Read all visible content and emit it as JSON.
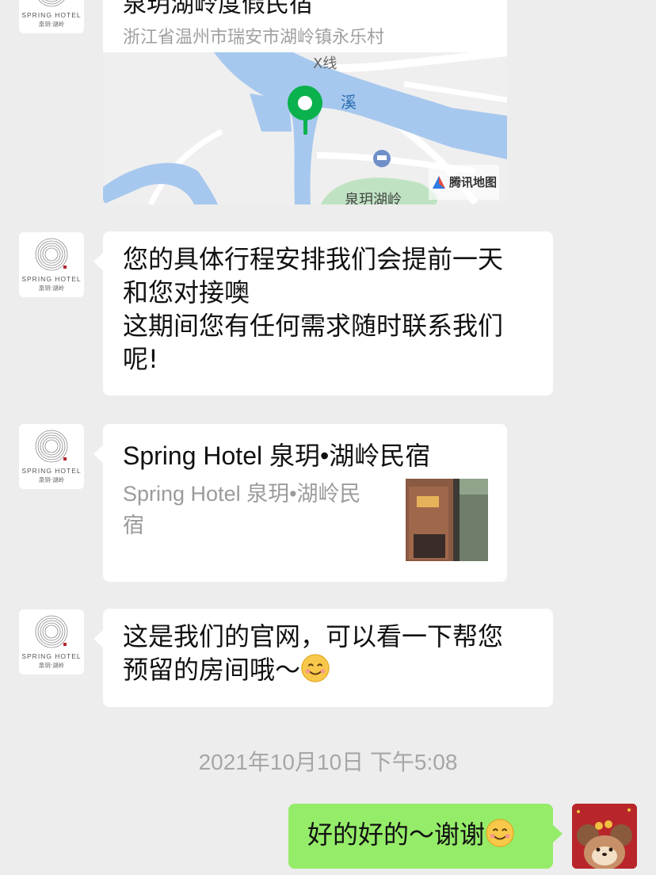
{
  "location_card": {
    "title": "泉玥湖岭度假民宿",
    "address": "浙江省温州市瑞安市湖岭镇永乐村",
    "map_provider": "腾讯地图",
    "map_labels": {
      "road": "X线",
      "river": "溪",
      "place": "泉玥湖岭"
    }
  },
  "avatar": {
    "brand": "SPRING HOTEL",
    "sub": "泉玥·湖岭",
    "seal": "玥"
  },
  "messages": {
    "m1_lines": [
      "您的具体行程安排我们会提前一天",
      "和您对接噢",
      "这期间您有任何需求随时联系我们",
      "呢!"
    ],
    "link": {
      "title": "Spring Hotel 泉玥•湖岭民宿",
      "desc_line1": "Spring Hotel 泉玥•湖岭民",
      "desc_line2": "宿"
    },
    "m3_line1": "这是我们的官网，可以看一下帮您",
    "m3_line2": "预留的房间哦～"
  },
  "timestamp": "2021年10月10日 下午5:08",
  "my_message": "好的好的～谢谢",
  "colors": {
    "background": "#ededed",
    "my_bubble": "#95ec69",
    "map_water": "#a7c8ee",
    "pin": "#0ab14c"
  }
}
